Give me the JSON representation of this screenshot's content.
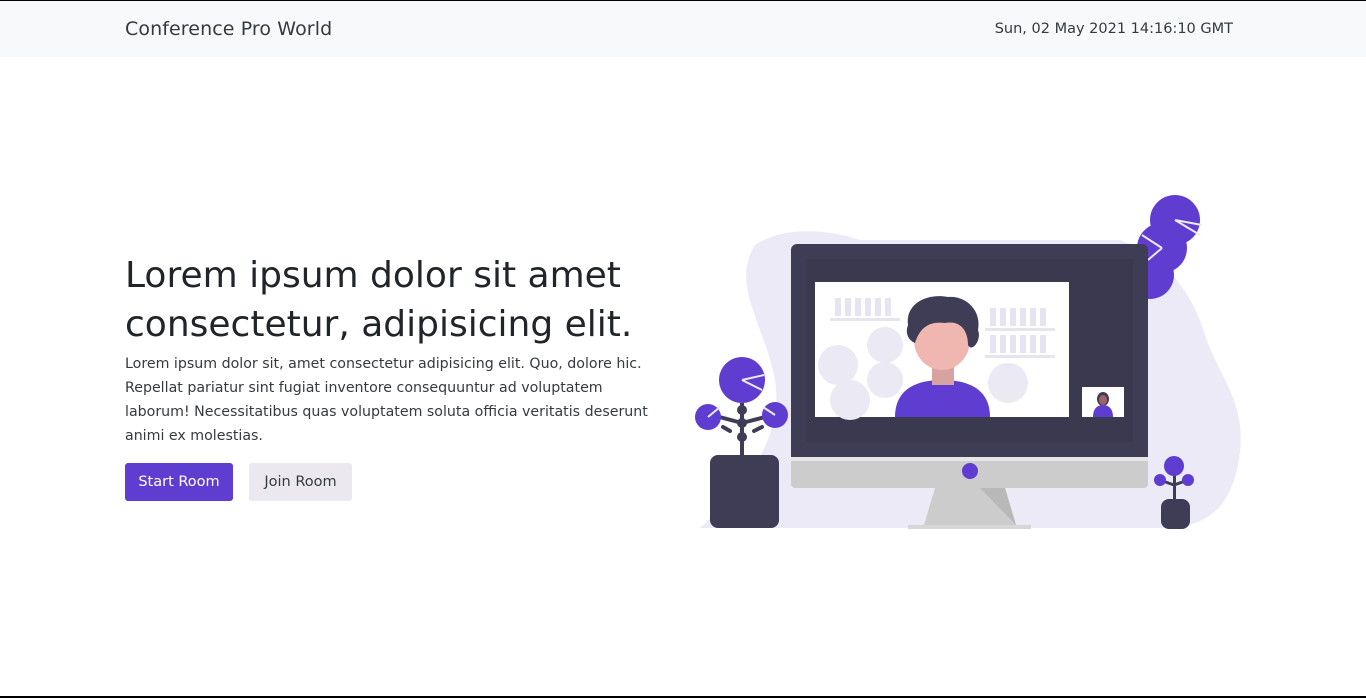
{
  "navbar": {
    "brand": "Conference Pro World",
    "datetime": "Sun, 02 May 2021 14:16:10 GMT"
  },
  "hero": {
    "title": "Lorem ipsum dolor sit amet consectetur, adipisicing elit.",
    "text": "Lorem ipsum dolor sit, amet consectetur adipisicing elit. Quo, dolore hic. Repellat pariatur sint fugiat inventore consequuntur ad voluptatem laborum! Necessitatibus quas voluptatem soluta officia veritatis deserunt animi ex molestias.",
    "buttons": {
      "start": "Start Room",
      "join": "Join Room"
    }
  },
  "colors": {
    "accent": "#5f3dd1",
    "navbar_bg": "#f8f9fa",
    "secondary_button_bg": "#ebe9ef",
    "illustration_blob": "#edeaf7",
    "monitor_frame": "#3f3d56"
  },
  "illustration": {
    "icon": "video-conference-illustration"
  }
}
